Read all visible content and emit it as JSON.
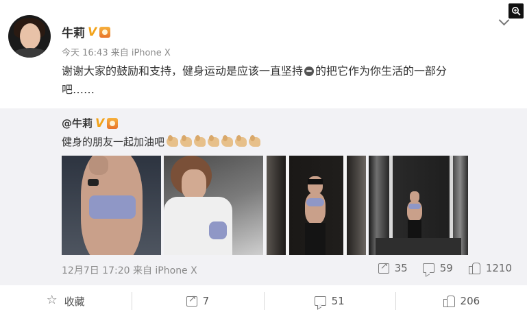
{
  "post": {
    "author": "牛莉",
    "meta": "今天 16:43 来自 iPhone X",
    "text_line1_before": "谢谢大家的鼓励和支持，健身运动是应该一直坚持",
    "text_line1_after": "的把它作为你生活的一部分",
    "text_line2": "吧……"
  },
  "repost": {
    "author": "@牛莉",
    "text": "健身的朋友一起加油吧",
    "meta": "12月7日 17:20 来自 iPhone X",
    "share_count": "35",
    "comment_count": "59",
    "like_count": "1210"
  },
  "actions": {
    "favorite_label": "收藏",
    "share_count": "7",
    "comment_count": "51",
    "like_count": "206"
  },
  "icons": {
    "verified": "V",
    "emoji_in_post": "face-emoji",
    "emoji_in_repost": "flexed-biceps"
  },
  "colors": {
    "verified_badge": "#f2a31a",
    "quote_background": "#f2f2f5",
    "meta_text": "#8a8a8a"
  }
}
